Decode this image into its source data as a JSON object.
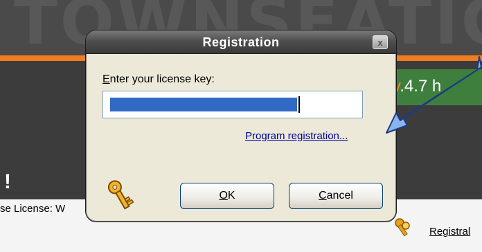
{
  "background": {
    "version_prefix": "v",
    "version_number": ".4.7 h",
    "left_mark": "!",
    "license_text": "se License: W",
    "registration_link": "Registral",
    "colors": {
      "accent": "#f07c1e",
      "banner": "#3e7f3e",
      "dark": "#3c3c3c"
    }
  },
  "dialog": {
    "title": "Registration",
    "close_glyph": "x",
    "label_mnemonic": "E",
    "label_rest": "nter your license key:",
    "license_key_value": "",
    "registration_link": "Program registration...",
    "ok_mnemonic": "O",
    "ok_rest": "K",
    "cancel_mnemonic": "C",
    "cancel_rest": "ancel",
    "icon": "keys-icon"
  },
  "annotation": {
    "icon": "arrow-pointer-icon",
    "color": "#8ab4ee"
  }
}
